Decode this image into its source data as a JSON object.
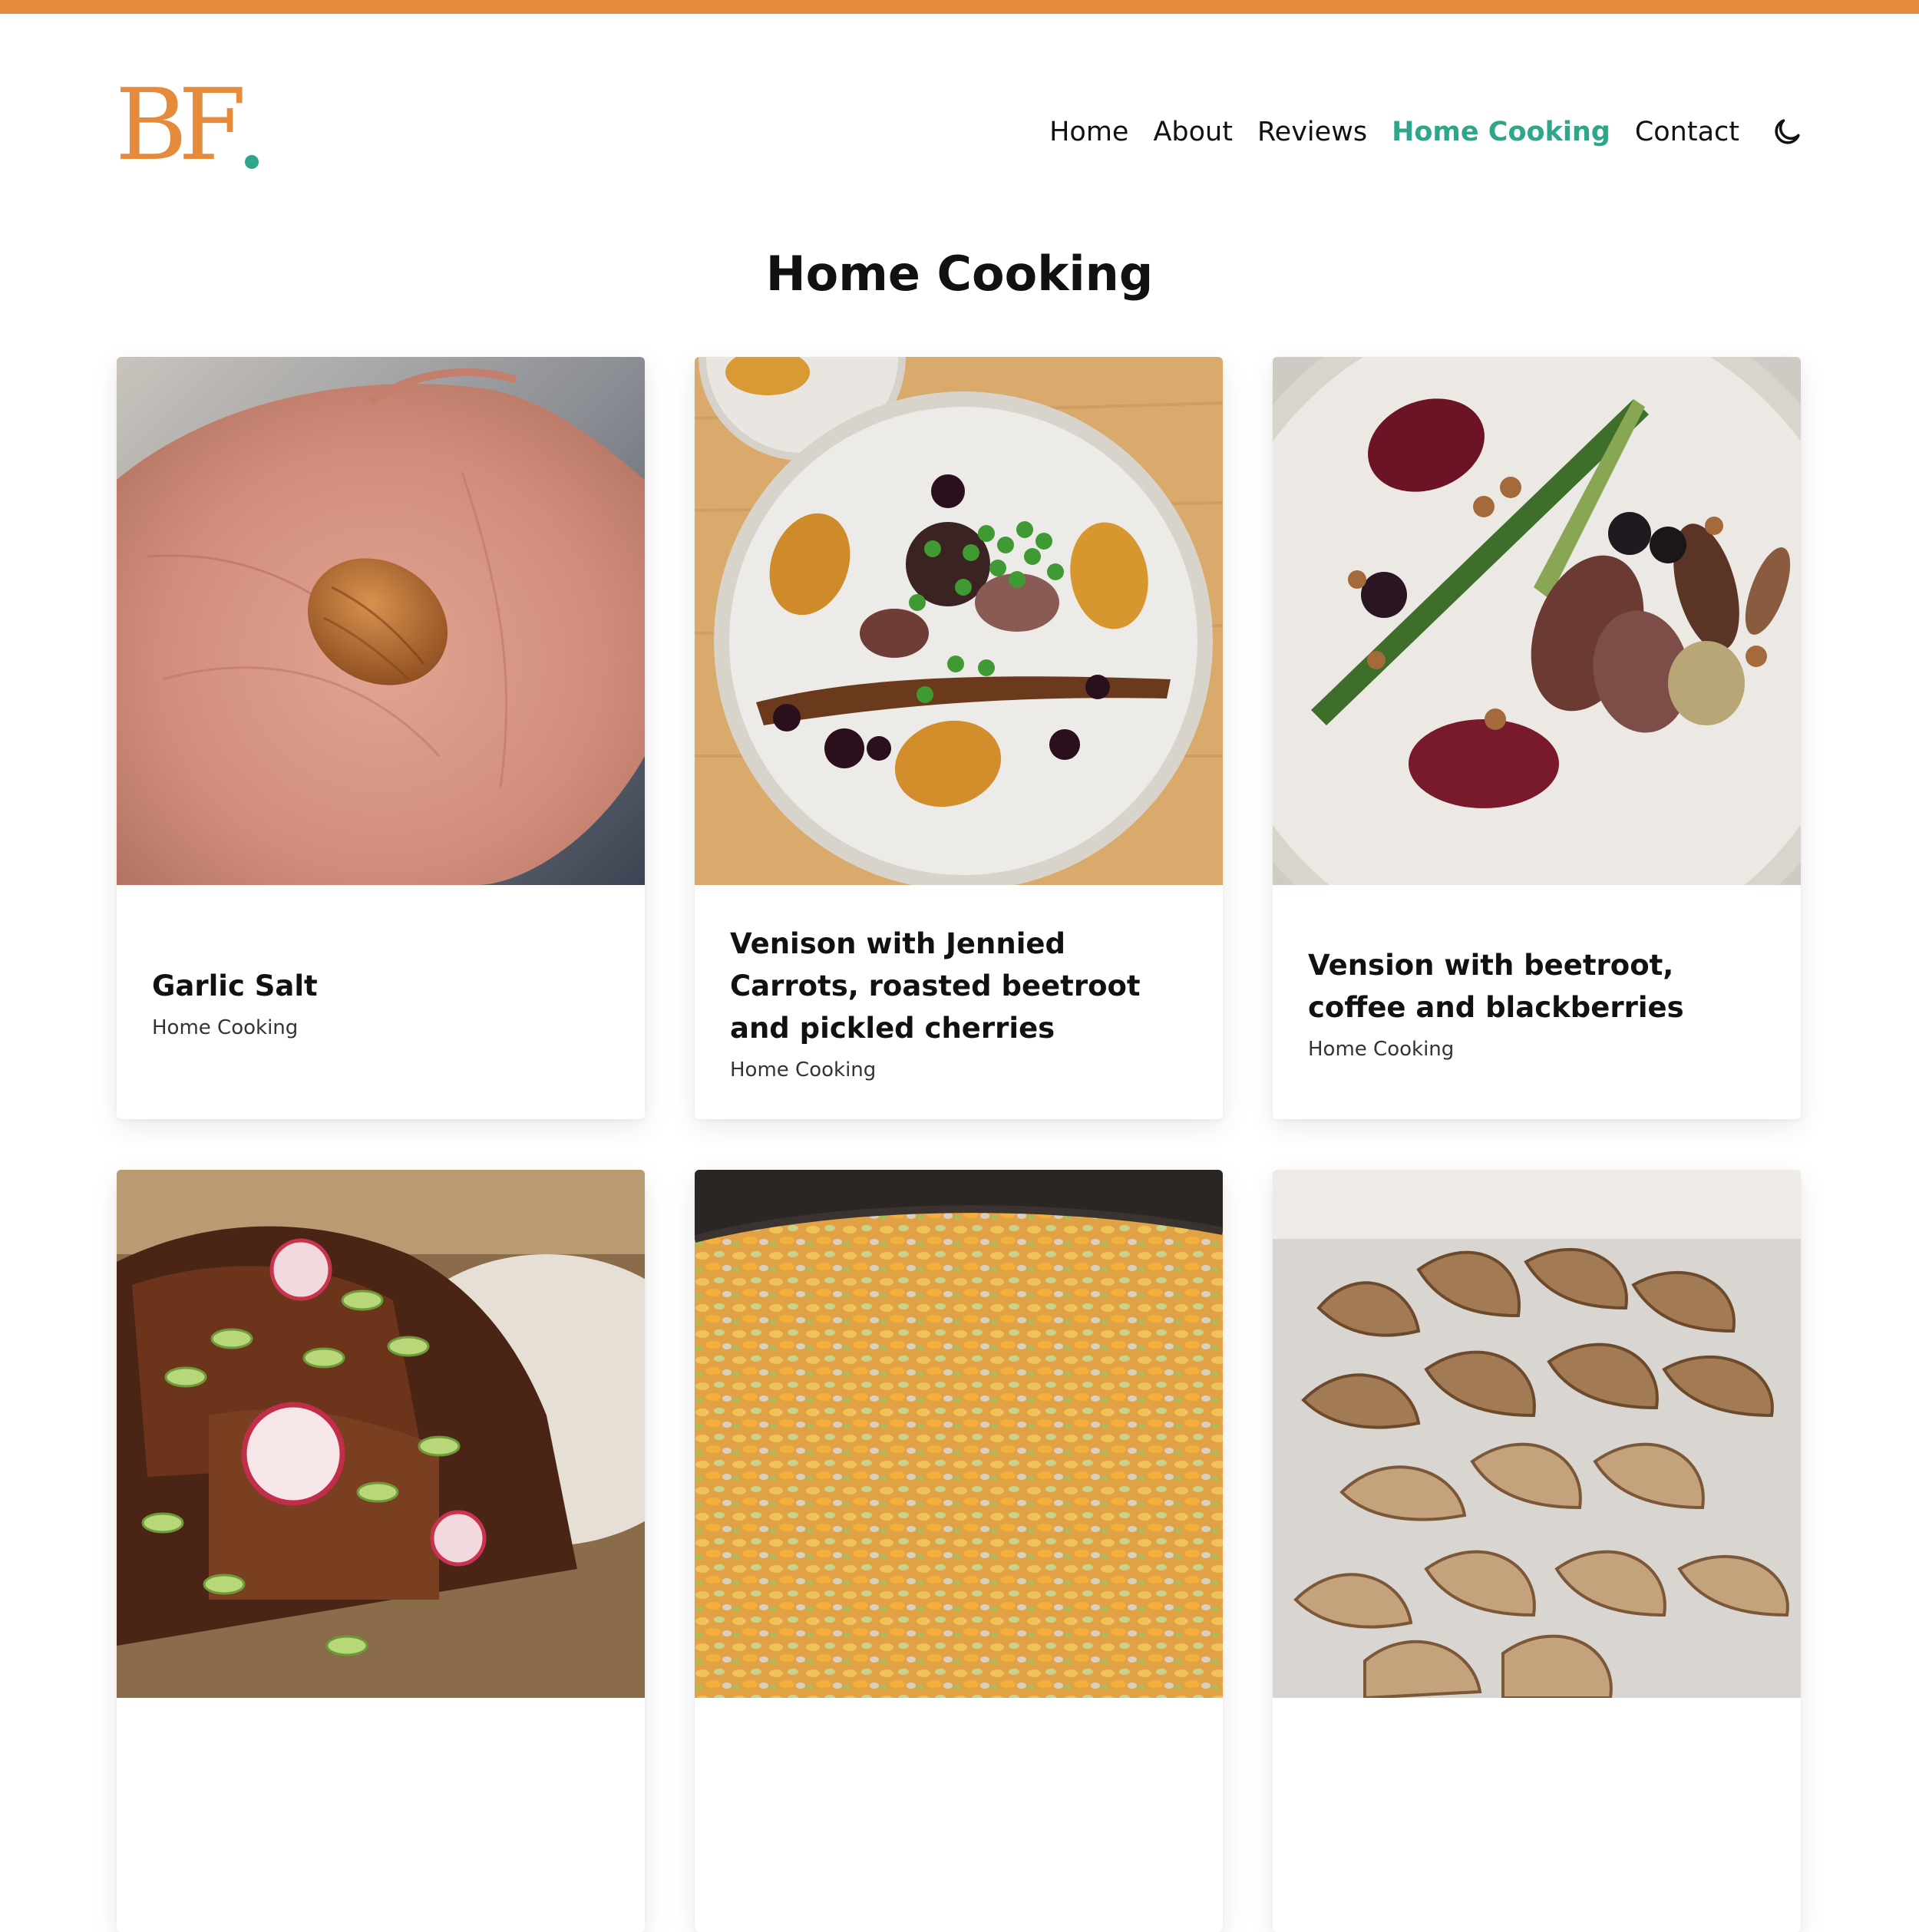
{
  "brand": {
    "logo_text": "BF",
    "accent": "#e68a3b",
    "dot_color": "#2fa58a"
  },
  "nav": {
    "items": [
      {
        "label": "Home",
        "active": false
      },
      {
        "label": "About",
        "active": false
      },
      {
        "label": "Reviews",
        "active": false
      },
      {
        "label": "Home Cooking",
        "active": true
      },
      {
        "label": "Contact",
        "active": false
      }
    ],
    "theme_toggle_icon": "moon-icon",
    "active_color": "#2fa58a"
  },
  "page": {
    "title": "Home Cooking"
  },
  "posts": [
    {
      "title": "Garlic Salt",
      "category": "Home Cooking",
      "image": "hand-holding-garlic-clove"
    },
    {
      "title": "Venison with Jennied Carrots, roasted beetroot and pickled cherries",
      "category": "Home Cooking",
      "image": "venison-plate-peas-carrot"
    },
    {
      "title": "Vension with beetroot, coffee and blackberries",
      "category": "Home Cooking",
      "image": "venison-plate-beetroot-spring-onion"
    },
    {
      "title": "",
      "category": "",
      "image": "glazed-meat-radish-spring-onion"
    },
    {
      "title": "",
      "category": "",
      "image": "pan-of-dried-flakes"
    },
    {
      "title": "",
      "category": "",
      "image": "dried-mushroom-pile"
    }
  ]
}
